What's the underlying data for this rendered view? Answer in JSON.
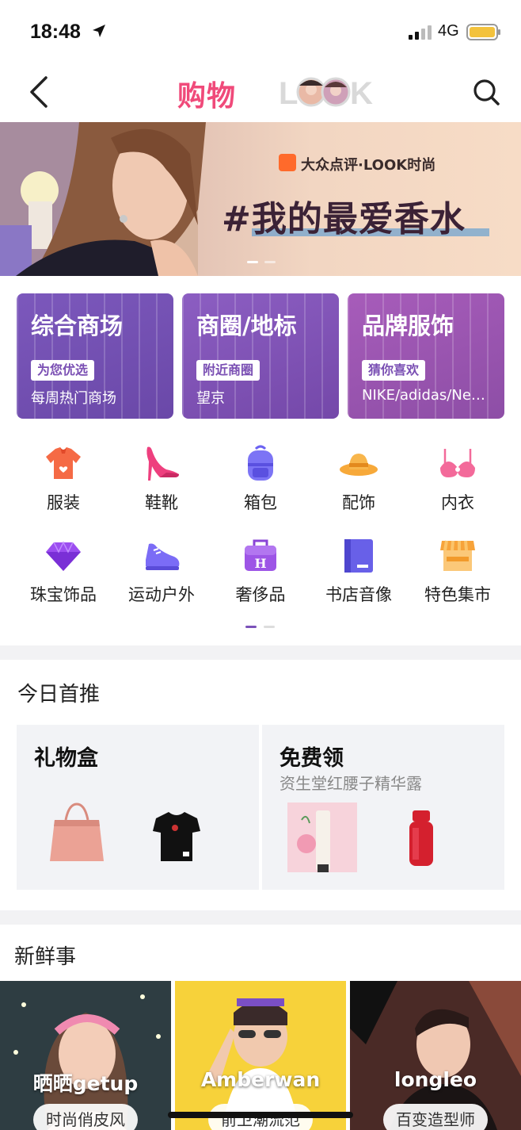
{
  "status": {
    "time": "18:48",
    "network": "4G"
  },
  "nav": {
    "tab_shop": "购物",
    "tab_look": "LOOK"
  },
  "banner": {
    "brand": "大众点评·LOOK时尚",
    "title": "#我的最爱香水"
  },
  "categories": [
    {
      "title": "综合商场",
      "tag": "为您优选",
      "sub": "每周热门商场",
      "color": "#7b52b9"
    },
    {
      "title": "商圈/地标",
      "tag": "附近商圈",
      "sub": "望京",
      "color": "#8a56bf"
    },
    {
      "title": "品牌服饰",
      "tag": "猜你喜欢",
      "sub": "NIKE/adidas/Ne…",
      "color": "#9b4fb0"
    }
  ],
  "icons": [
    {
      "label": "服装",
      "icon": "clothing-icon"
    },
    {
      "label": "鞋靴",
      "icon": "high-heel-icon"
    },
    {
      "label": "箱包",
      "icon": "backpack-icon"
    },
    {
      "label": "配饰",
      "icon": "hat-icon"
    },
    {
      "label": "内衣",
      "icon": "bra-icon"
    },
    {
      "label": "珠宝饰品",
      "icon": "diamond-icon"
    },
    {
      "label": "运动户外",
      "icon": "sneaker-icon"
    },
    {
      "label": "奢侈品",
      "icon": "luxury-bag-icon"
    },
    {
      "label": "书店音像",
      "icon": "book-icon"
    },
    {
      "label": "特色集市",
      "icon": "market-stall-icon"
    }
  ],
  "today": {
    "title": "今日首推",
    "gift_box": {
      "title": "礼物盒"
    },
    "free": {
      "title": "免费领",
      "desc": "资生堂红腰子精华露"
    }
  },
  "fresh": {
    "title": "新鲜事",
    "items": [
      {
        "name": "晒晒getup",
        "tag": "时尚俏皮风"
      },
      {
        "name": "Amberwan",
        "tag": "前卫潮流范"
      },
      {
        "name": "longleo",
        "tag": "百变造型师"
      }
    ]
  },
  "colors": {
    "accent": "#f04a7a",
    "purple": "#7b52b9",
    "divider": "#f2f2f4"
  }
}
